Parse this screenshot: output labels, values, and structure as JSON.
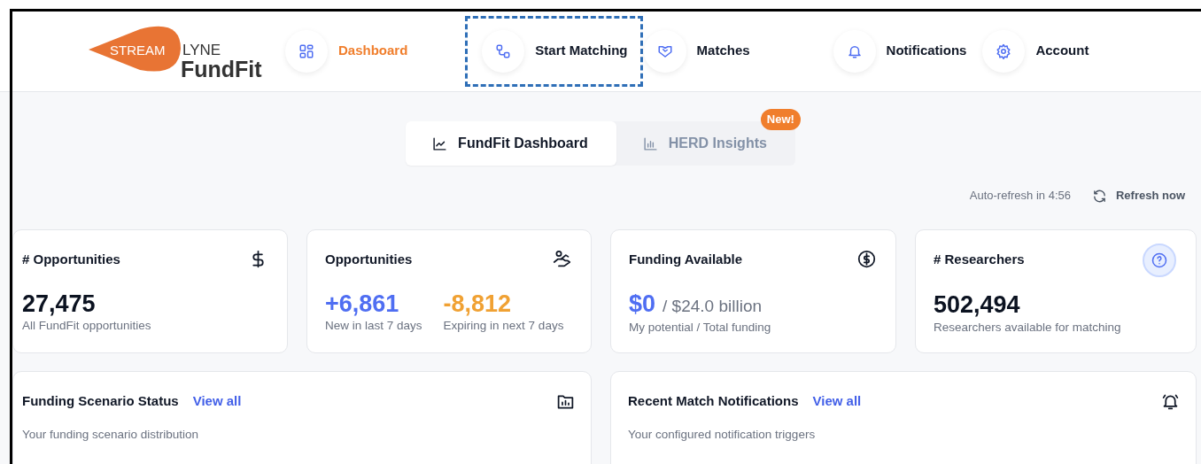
{
  "logo": {
    "part_1": "STREAM",
    "part_2": "LYNE",
    "product": "FundFit"
  },
  "nav": [
    {
      "label": "Dashboard",
      "selected": true,
      "highlighted": false
    },
    {
      "label": "Start Matching",
      "selected": false,
      "highlighted": true
    },
    {
      "label": "Matches",
      "selected": false,
      "highlighted": false
    },
    {
      "label": "Notifications",
      "selected": false,
      "highlighted": false
    },
    {
      "label": "Account",
      "selected": false,
      "highlighted": false
    }
  ],
  "tabs": [
    {
      "label": "FundFit Dashboard",
      "selected": true
    },
    {
      "label": "HERD Insights",
      "selected": false,
      "badge": "New!"
    }
  ],
  "refresh": {
    "countdown": "Auto-refresh in 4:56",
    "button": "Refresh now"
  },
  "stats": [
    {
      "title": "# Opportunities",
      "values": [
        {
          "value": "27,475",
          "caption": "All FundFit opportunities",
          "color": "#0b1220"
        }
      ]
    },
    {
      "title": "Opportunities",
      "values": [
        {
          "value": "+6,861",
          "caption": "New in last 7 days",
          "color": "#4f6ef2"
        },
        {
          "value": "-8,812",
          "caption": "Expiring in next 7 days",
          "color": "#f0a133"
        }
      ]
    },
    {
      "title": "Funding Available",
      "values": [
        {
          "value": "$0",
          "total": "/ $24.0 billion",
          "caption": "My potential / Total funding",
          "color": "#4f6ef2"
        }
      ]
    },
    {
      "title": "# Researchers",
      "values": [
        {
          "value": "502,494",
          "caption": "Researchers available for matching",
          "color": "#0b1220"
        }
      ]
    }
  ],
  "panels": [
    {
      "title": "Funding Scenario Status",
      "link": "View all",
      "subtitle": "Your funding scenario distribution"
    },
    {
      "title": "Recent Match Notifications",
      "link": "View all",
      "subtitle": "Your configured notification triggers"
    }
  ]
}
